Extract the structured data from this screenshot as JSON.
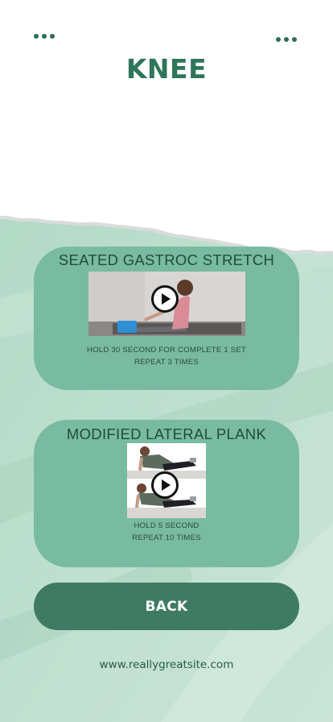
{
  "header": {
    "title": "KNEE",
    "left_menu_icon": "more-dots-icon",
    "right_menu_icon": "more-dots-icon"
  },
  "exercises": [
    {
      "title": "SEATED GASTROC STRETCH",
      "thumbnail_icon": "play-icon",
      "instructions": [
        "HOLD 30 SECOND FOR COMPLETE 1 SET",
        "REPEAT 3 TIMES"
      ]
    },
    {
      "title": "MODIFIED LATERAL PLANK",
      "thumbnail_icon": "play-icon",
      "instructions": [
        "HOLD 5 SECOND",
        "REPEAT 10 TIMES"
      ]
    }
  ],
  "back_button": {
    "label": "BACK"
  },
  "footer": {
    "website": "www.reallygreatsite.com"
  },
  "colors": {
    "accent": "#2f7559",
    "card": "#79bba0",
    "button": "#3f7b62",
    "background_green": "#b8dccb"
  }
}
